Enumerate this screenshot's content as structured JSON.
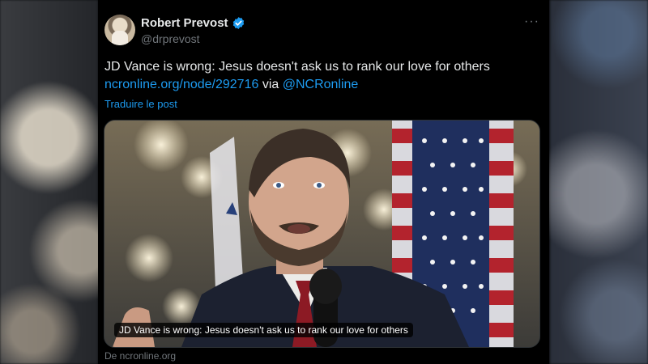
{
  "author": {
    "name": "Robert Prevost",
    "handle": "@drprevost",
    "verified": true
  },
  "post": {
    "text": "JD Vance is wrong: Jesus doesn't ask us to rank our love for others",
    "link_text": "ncronline.org/node/292716",
    "via_text": " via ",
    "mention": "@NCRonline",
    "translate_label": "Traduire le post"
  },
  "card": {
    "caption": "JD Vance is wrong: Jesus doesn't ask us to rank our love for others",
    "source": "De ncronline.org"
  },
  "menu": {
    "more_label": "···"
  },
  "colors": {
    "link": "#1d9bf0",
    "verified_badge": "#1d9bf0",
    "background": "#000000",
    "text": "#e7e9ea",
    "muted": "#71767b"
  }
}
